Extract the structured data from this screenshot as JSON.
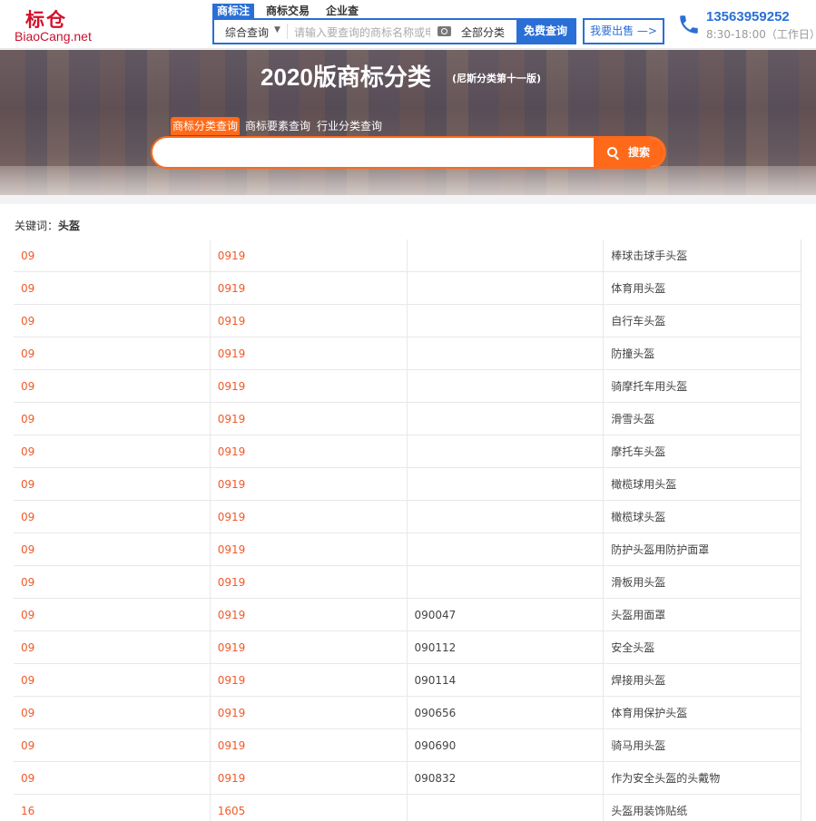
{
  "header": {
    "logo_cn": "标仓",
    "logo_en": "BiaoCang.net",
    "search_tabs": [
      {
        "label": "商标注",
        "active": true
      },
      {
        "label": "商标交易",
        "active": false
      },
      {
        "label": "企业查",
        "active": false
      }
    ],
    "search_scope": "综合查询",
    "search_placeholder": "请输入要查询的商标名称或申请号",
    "category_select": "全部分类",
    "search_button": "免费查询",
    "sell_button": "我要出售 —>",
    "phone": "13563959252",
    "hours": "8:30-18:00（工作日）"
  },
  "banner": {
    "title": "2020版商标分类",
    "subtitle": "(尼斯分类第十一版)",
    "tabs": [
      {
        "label": "商标分类查询",
        "active": true
      },
      {
        "label": "商标要素查询",
        "active": false
      },
      {
        "label": "行业分类查询",
        "active": false
      }
    ],
    "search_value": "",
    "search_button": "搜索"
  },
  "results": {
    "keyword_label": "关键词：",
    "keyword": "头盔",
    "rows": [
      {
        "cls": "09",
        "group": "0919",
        "code": "",
        "name": "棒球击球手头盔"
      },
      {
        "cls": "09",
        "group": "0919",
        "code": "",
        "name": "体育用头盔"
      },
      {
        "cls": "09",
        "group": "0919",
        "code": "",
        "name": "自行车头盔"
      },
      {
        "cls": "09",
        "group": "0919",
        "code": "",
        "name": "防撞头盔"
      },
      {
        "cls": "09",
        "group": "0919",
        "code": "",
        "name": "骑摩托车用头盔"
      },
      {
        "cls": "09",
        "group": "0919",
        "code": "",
        "name": "滑雪头盔"
      },
      {
        "cls": "09",
        "group": "0919",
        "code": "",
        "name": "摩托车头盔"
      },
      {
        "cls": "09",
        "group": "0919",
        "code": "",
        "name": "橄榄球用头盔"
      },
      {
        "cls": "09",
        "group": "0919",
        "code": "",
        "name": "橄榄球头盔"
      },
      {
        "cls": "09",
        "group": "0919",
        "code": "",
        "name": "防护头盔用防护面罩"
      },
      {
        "cls": "09",
        "group": "0919",
        "code": "",
        "name": "滑板用头盔"
      },
      {
        "cls": "09",
        "group": "0919",
        "code": "090047",
        "name": "头盔用面罩"
      },
      {
        "cls": "09",
        "group": "0919",
        "code": "090112",
        "name": "安全头盔"
      },
      {
        "cls": "09",
        "group": "0919",
        "code": "090114",
        "name": "焊接用头盔"
      },
      {
        "cls": "09",
        "group": "0919",
        "code": "090656",
        "name": "体育用保护头盔"
      },
      {
        "cls": "09",
        "group": "0919",
        "code": "090690",
        "name": "骑马用头盔"
      },
      {
        "cls": "09",
        "group": "0919",
        "code": "090832",
        "name": "作为安全头盔的头戴物"
      },
      {
        "cls": "16",
        "group": "1605",
        "code": "",
        "name": "头盔用装饰贴纸"
      }
    ]
  },
  "colors": {
    "brand_red": "#d4102a",
    "accent_blue": "#2a6fd6",
    "accent_orange": "#ff6a1a",
    "code_orange": "#f05a28"
  }
}
